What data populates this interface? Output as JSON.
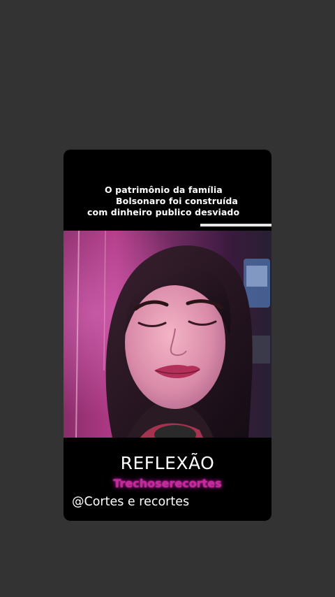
{
  "caption": {
    "line1": "O patrimônio da família",
    "line2": "Bolsonaro foi construída",
    "line3": "com dinheiro publico desviado"
  },
  "overlay": {
    "title": "REFLEXÃO",
    "subtitle": "Trechoserecortes",
    "handle": "@Cortes e recortes"
  },
  "colors": {
    "background": "#333333",
    "card": "#000000",
    "subtitle_glow": "#c32a9a"
  }
}
